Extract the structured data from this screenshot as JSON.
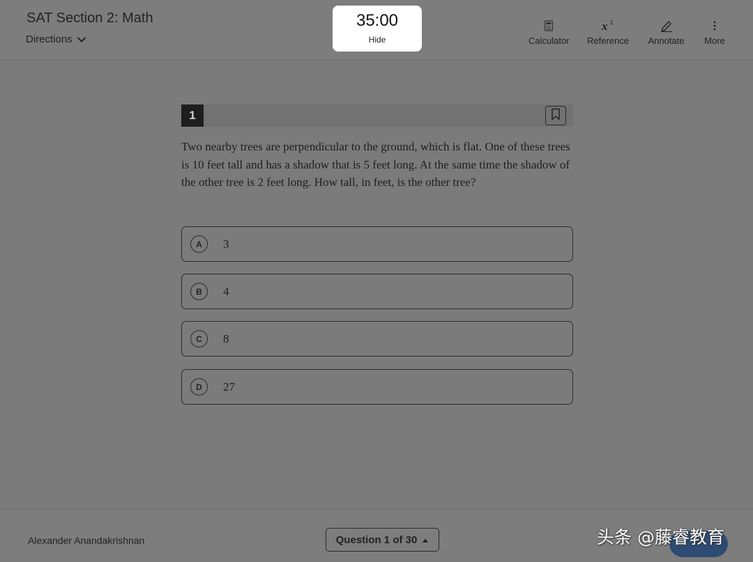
{
  "header": {
    "section_title": "SAT Section 2: Math",
    "directions_label": "Directions",
    "timer": {
      "time": "35:00",
      "hide_label": "Hide"
    },
    "tools": [
      {
        "label": "Calculator",
        "icon": "calculator-icon"
      },
      {
        "label": "Reference",
        "icon": "reference-icon"
      },
      {
        "label": "Annotate",
        "icon": "annotate-icon"
      },
      {
        "label": "More",
        "icon": "more-icon"
      }
    ]
  },
  "question": {
    "number": "1",
    "text": "Two nearby trees are perpendicular to the ground, which is flat. One of these trees is 10 feet tall and has a shadow that is 5 feet long. At the same time the shadow of the other tree is 2 feet long. How tall, in feet, is the other tree?",
    "choices": [
      {
        "letter": "A",
        "text": "3"
      },
      {
        "letter": "B",
        "text": "4"
      },
      {
        "letter": "C",
        "text": "8"
      },
      {
        "letter": "D",
        "text": "27"
      }
    ]
  },
  "footer": {
    "student_name": "Alexander Anandakrishnan",
    "question_nav": "Question 1 of 30",
    "watermark": "头条 @藤睿教育"
  },
  "colors": {
    "overlay_background": "#7b7b7b",
    "timer_background": "#ffffff",
    "next_button": "#2e4b73"
  }
}
